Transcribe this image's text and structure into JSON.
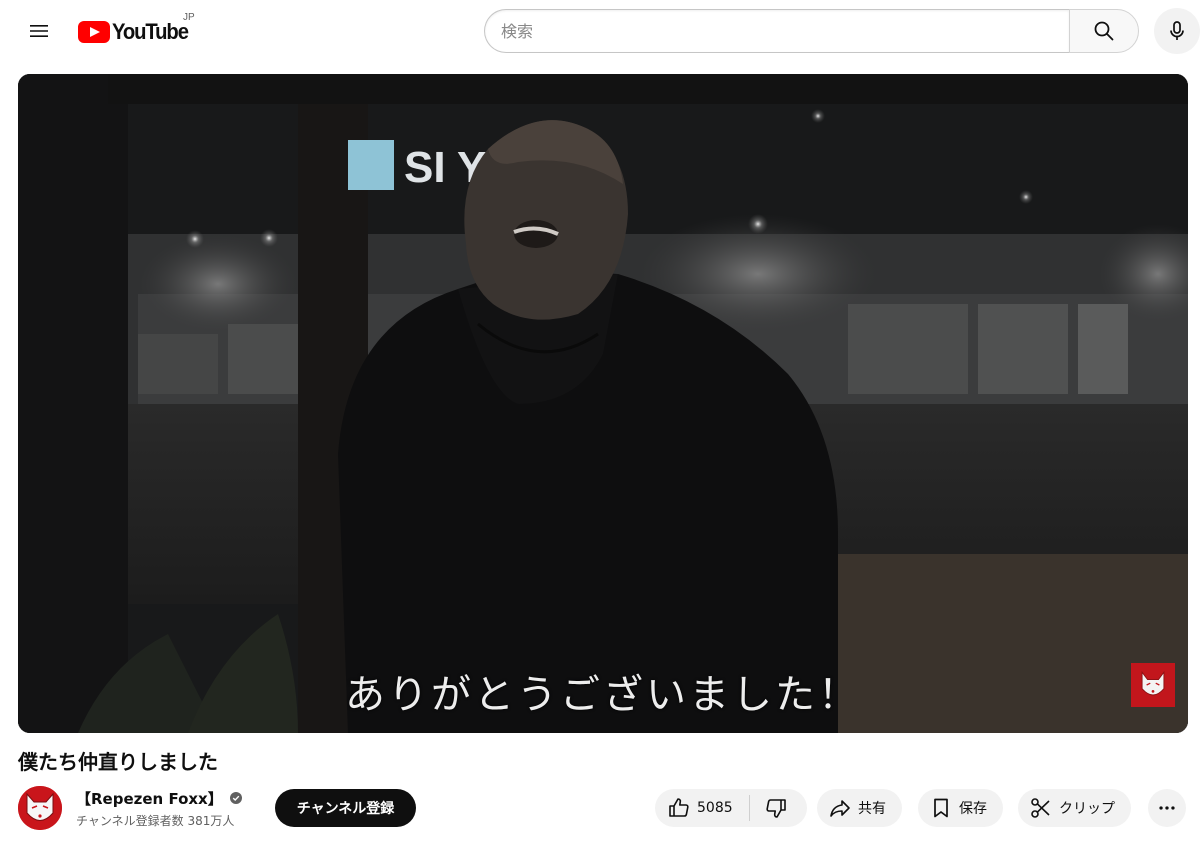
{
  "masthead": {
    "logo_text": "YouTube",
    "country_code": "JP",
    "search_placeholder": "検索",
    "search_value": ""
  },
  "player": {
    "subtitle": "ありがとうございました！",
    "storefront_sign": "SI  Y"
  },
  "video": {
    "title": "僕たち仲直りしました"
  },
  "owner": {
    "channel_name": "【Repezen Foxx】",
    "subscriber_count": "チャンネル登録者数 381万人",
    "subscribe_label": "チャンネル登録"
  },
  "actions": {
    "like_count": "5085",
    "share_label": "共有",
    "save_label": "保存",
    "clip_label": "クリップ"
  },
  "icons": {
    "menu": "hamburger-icon",
    "search": "search-icon",
    "mic": "mic-icon",
    "like": "thumbs-up-icon",
    "dislike": "thumbs-down-icon",
    "share": "share-arrow-icon",
    "save": "bookmark-icon",
    "clip": "scissors-icon",
    "more": "more-horizontal-icon",
    "verified": "verified-check-icon"
  },
  "colors": {
    "brand_red": "#ff0000",
    "subscribe_bg": "#0f0f0f",
    "pill_bg": "#f2f2f2",
    "secondary_text": "#606060"
  }
}
